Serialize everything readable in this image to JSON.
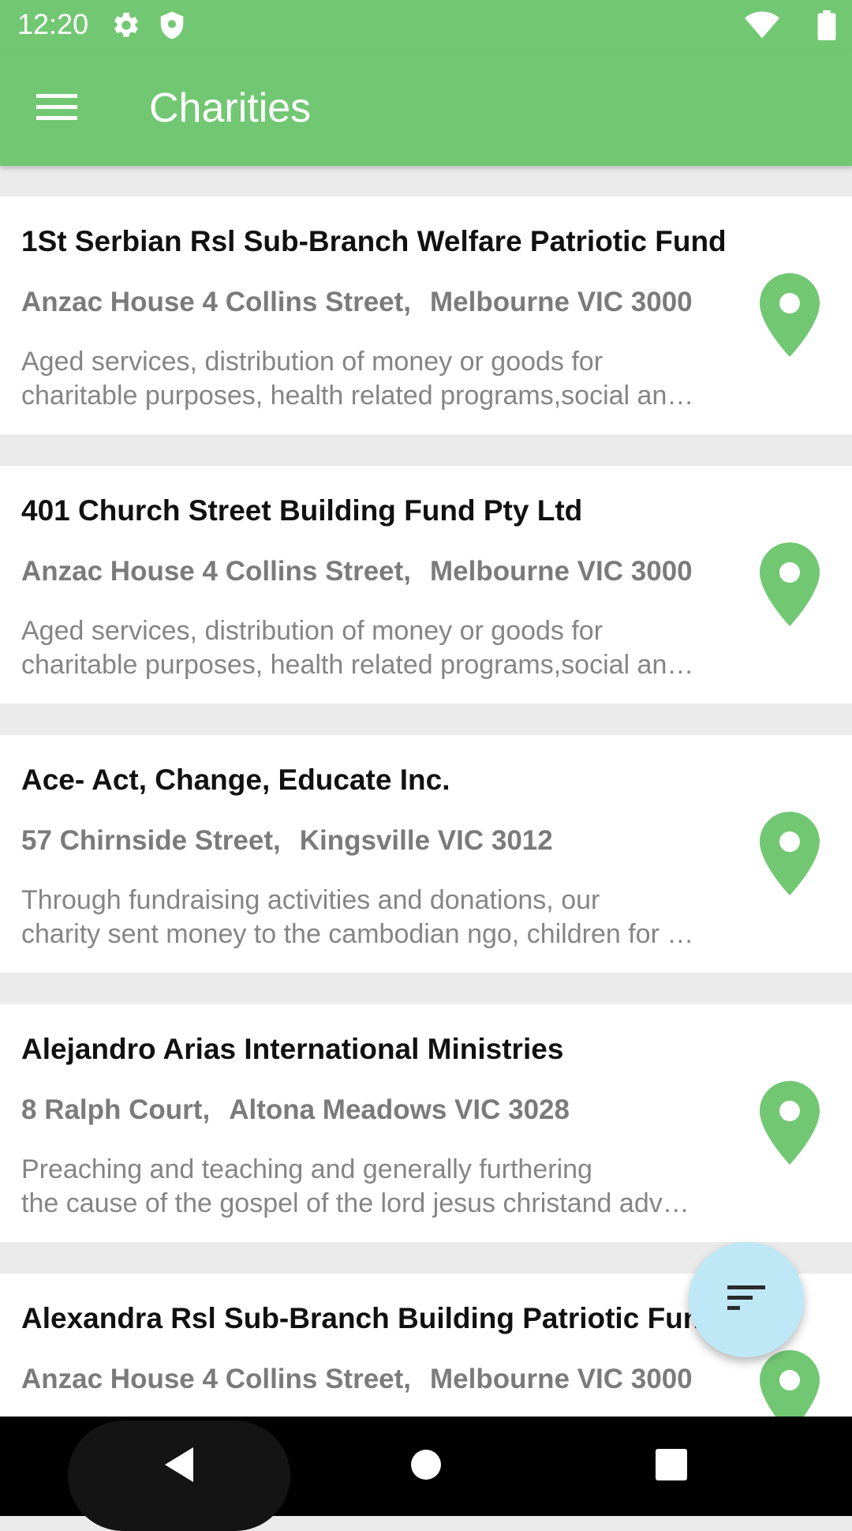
{
  "status_bar": {
    "time": "12:20",
    "icons": [
      "gear-icon",
      "shield-icon",
      "wifi-icon",
      "battery-icon"
    ]
  },
  "app_bar": {
    "title": "Charities",
    "menu_icon": "hamburger-menu-icon"
  },
  "colors": {
    "primary": "#72c773",
    "fab": "#bfe8f6",
    "list_background": "#ebebeb",
    "name_text": "#111111",
    "address_text": "#7b7b7b",
    "description_text": "#858585"
  },
  "charities": [
    {
      "name": "1St Serbian Rsl Sub-Branch Welfare Patriotic Fund",
      "street": "Anzac House 4 Collins Street,",
      "city": "Melbourne VIC 3000",
      "desc_line1": "Aged services, distribution of money or goods for",
      "desc_line2": "charitable purposes, health related programs,social an…"
    },
    {
      "name": "401 Church Street Building Fund Pty Ltd",
      "street": "Anzac House 4 Collins Street,",
      "city": "Melbourne VIC 3000",
      "desc_line1": "Aged services, distribution of money or goods for",
      "desc_line2": "charitable purposes, health related programs,social an…"
    },
    {
      "name": "Ace- Act, Change, Educate Inc.",
      "street": "57 Chirnside Street,",
      "city": "Kingsville VIC 3012",
      "desc_line1": "Through fundraising activities and donations, our",
      "desc_line2": "charity sent money to the cambodian ngo, children for …"
    },
    {
      "name": "Alejandro Arias International Ministries",
      "street": "8 Ralph Court,",
      "city": "Altona Meadows VIC 3028",
      "desc_line1": "Preaching and teaching and generally furthering",
      "desc_line2": "the cause of the gospel of the lord jesus christand adv…"
    },
    {
      "name": "Alexandra Rsl Sub-Branch Building Patriotic Fund 978",
      "street": "Anzac House 4 Collins Street,",
      "city": "Melbourne VIC 3000",
      "desc_line1": "",
      "desc_line2": ""
    }
  ],
  "fab": {
    "icon": "sort-icon"
  },
  "nav_bar": {
    "icons": [
      "back-icon",
      "home-icon",
      "recents-icon"
    ]
  }
}
